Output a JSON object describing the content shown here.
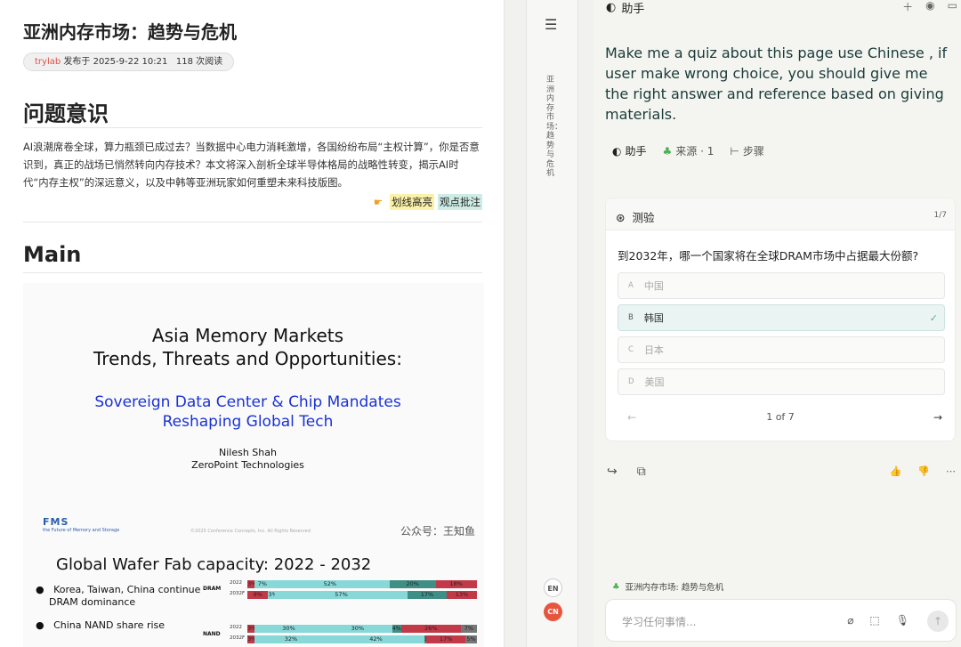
{
  "article": {
    "title": "亚洲内存市场：趋势与危机",
    "author": "trylab",
    "published": "发布于 2025-9-22 10:21",
    "reads": "118 次阅读",
    "section1": "问题意识",
    "paragraph": "AI浪潮席卷全球，算力瓶颈已成过去？当数据中心电力消耗激增，各国纷纷布局“主权计算”，你是否意识到，真正的战场已悄然转向内存技术？本文将深入剖析全球半导体格局的战略性转变，揭示AI时代“内存主权”的深远意义，以及中韩等亚洲玩家如何重塑未来科技版图。",
    "hl_label": "划线高亮",
    "note_label": "观点批注",
    "section2": "Main"
  },
  "slide1": {
    "title1": "Asia Memory Markets",
    "title2": "Trends, Threats and Opportunities:",
    "blue1": "Sovereign Data Center & Chip Mandates",
    "blue2": "Reshaping Global Tech",
    "name": "Nilesh Shah",
    "company": "ZeroPoint Technologies",
    "logo": "FMS",
    "logo_sub": "the Future of Memory and Storage",
    "copyright": "©2025 Conference Concepts, Inc. All Rights Reserved",
    "wechat": "公众号：王知鱼"
  },
  "slide2": {
    "title": "Global Wafer Fab capacity: 2022 - 2032",
    "bullet1a": "Korea, Taiwan, China continue",
    "bullet1b": "DRAM dominance",
    "bullet2": "China NAND share  rise",
    "dram": "DRAM",
    "nand": "NAND",
    "rows": [
      {
        "year": "2022",
        "segs": [
          {
            "v": 3,
            "t": "3%",
            "c": "#c23a48"
          },
          {
            "v": 7,
            "t": "7%",
            "c": "#88d8d8"
          },
          {
            "v": 52,
            "t": "52%",
            "c": "#88d8d8"
          },
          {
            "v": 20,
            "t": "20%",
            "c": "#3f8f86"
          },
          {
            "v": 18,
            "t": "18%",
            "c": "#c23a48"
          }
        ]
      },
      {
        "year": "2032F",
        "segs": [
          {
            "v": 9,
            "t": "9%",
            "c": "#c23a48"
          },
          {
            "v": 3,
            "t": "3%",
            "c": "#88d8d8"
          },
          {
            "v": 57,
            "t": "57%",
            "c": "#88d8d8"
          },
          {
            "v": 17,
            "t": "17%",
            "c": "#3f8f86"
          },
          {
            "v": 13,
            "t": "13%",
            "c": "#c23a48"
          }
        ]
      },
      {
        "year": "2022",
        "segs": [
          {
            "v": 3,
            "t": "3%",
            "c": "#c23a48"
          },
          {
            "v": 30,
            "t": "30%",
            "c": "#88d8d8"
          },
          {
            "v": 30,
            "t": "30%",
            "c": "#88d8d8"
          },
          {
            "v": 4,
            "t": "4%",
            "c": "#3f8f86"
          },
          {
            "v": 26,
            "t": "26%",
            "c": "#c23a48"
          },
          {
            "v": 7,
            "t": "7%",
            "c": "#777"
          }
        ]
      },
      {
        "year": "2032F",
        "segs": [
          {
            "v": 3,
            "t": "3%",
            "c": "#c23a48"
          },
          {
            "v": 32,
            "t": "32%",
            "c": "#88d8d8"
          },
          {
            "v": 42,
            "t": "42%",
            "c": "#88d8d8"
          },
          {
            "v": 1,
            "t": "1%",
            "c": "#3f8f86"
          },
          {
            "v": 17,
            "t": "17%",
            "c": "#c23a48"
          },
          {
            "v": 5,
            "t": "5%",
            "c": "#777"
          }
        ]
      }
    ]
  },
  "rail": {
    "menu_icon": "menu-icon",
    "vertical_title": "亚洲内存市场：趋势与危机",
    "en": "EN",
    "cn": "CN"
  },
  "assistant": {
    "header": "助手",
    "prompt": "Make me a quiz about this page use Chinese , if user make wrong choice, you should give me the right answer and reference based on giving materials.",
    "tab_assistant": "助手",
    "tab_sources": "来源 · 1",
    "tab_steps": "步骤",
    "quiz_title": "测验",
    "quiz_count": "1/7",
    "question": "到2032年，哪一个国家将在全球DRAM市场中占据最大份额?",
    "options": [
      {
        "letter": "A",
        "text": "中国"
      },
      {
        "letter": "B",
        "text": "韩国"
      },
      {
        "letter": "C",
        "text": "日本"
      },
      {
        "letter": "D",
        "text": "美国"
      }
    ],
    "pager": "1 of 7",
    "context_label": "亚洲内存市场: 趋势与危机",
    "input_placeholder": "学习任何事情..."
  }
}
